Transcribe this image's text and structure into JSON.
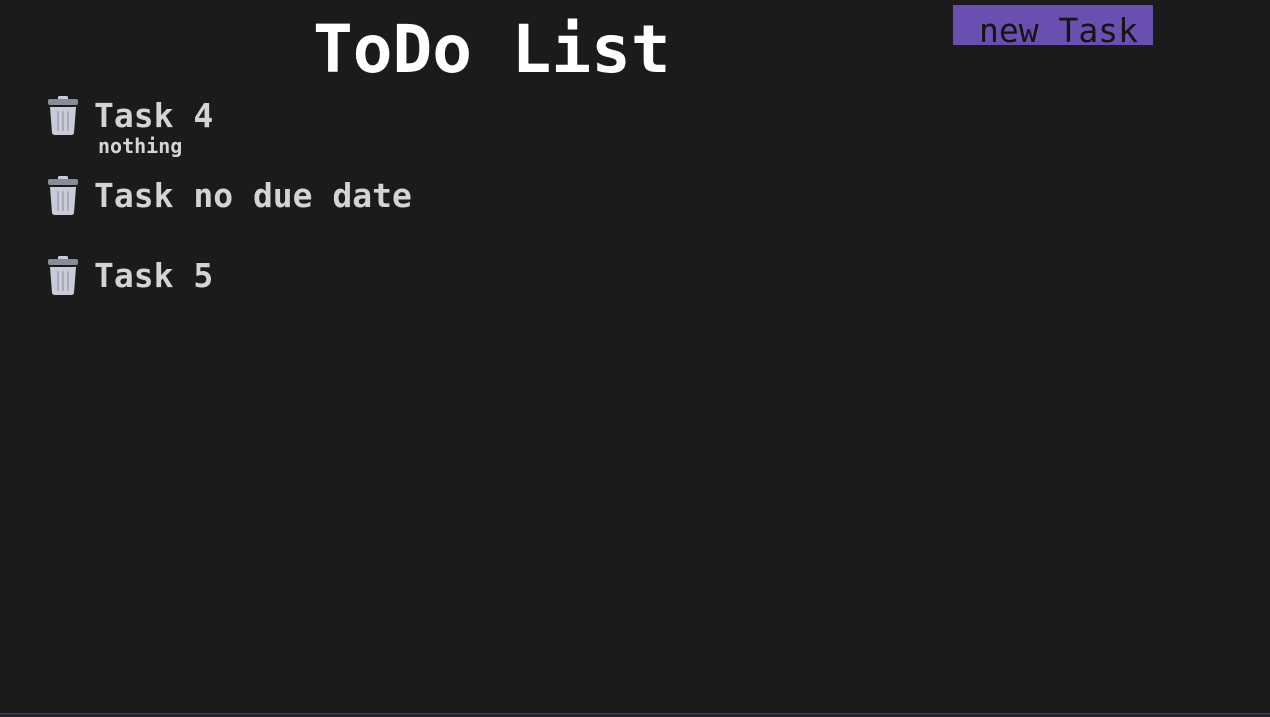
{
  "app": {
    "title": "ToDo List"
  },
  "toolbar": {
    "new_task_label": "new Task",
    "accent_color": "#6a4fb0"
  },
  "tasks": [
    {
      "title": "Task 4",
      "description": "nothing",
      "delete_icon": "trash-icon"
    },
    {
      "title": "Task no due date",
      "description": "",
      "delete_icon": "trash-icon"
    },
    {
      "title": "Task 5",
      "description": "",
      "delete_icon": "trash-icon"
    }
  ],
  "colors": {
    "background": "#1b1b1b",
    "text": "#d4d4d4",
    "title": "#ffffff",
    "trash_body": "#c9ccd8",
    "trash_lid": "#8a8d96"
  }
}
